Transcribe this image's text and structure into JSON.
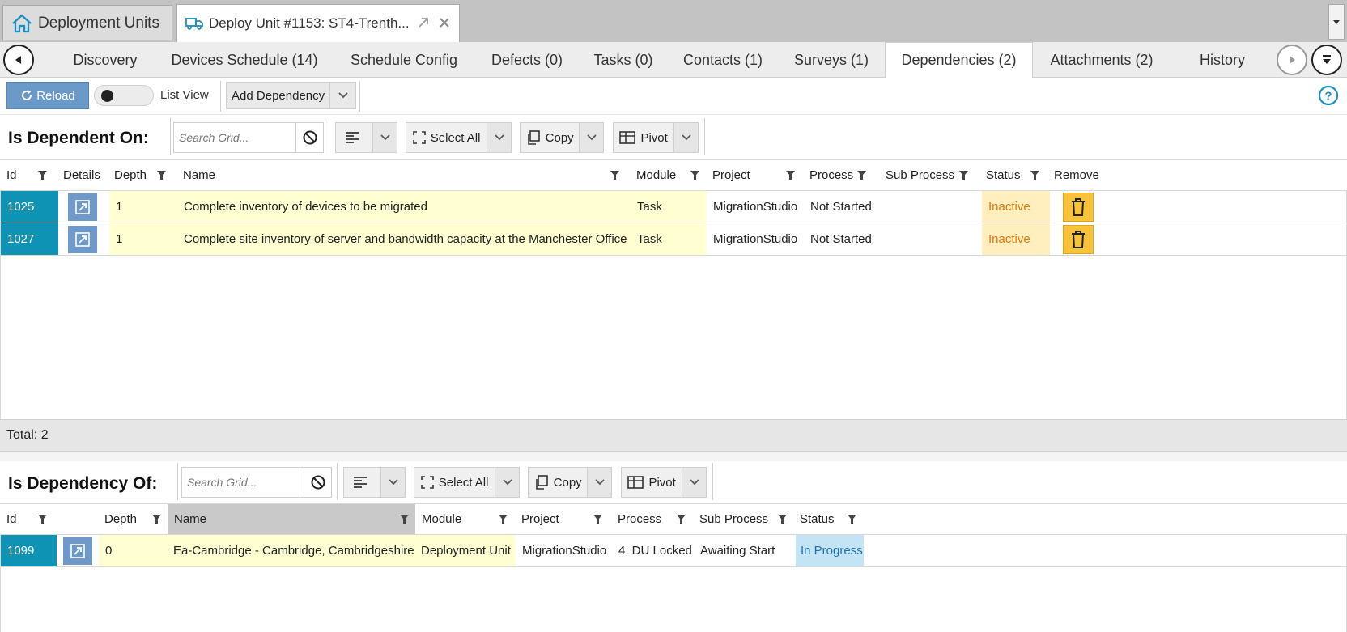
{
  "doc_tabs": {
    "home_tab": "Deployment Units",
    "active_tab": "Deploy Unit #1153: ST4-Trenth..."
  },
  "sub_tabs": [
    "Discovery",
    "Devices Schedule (14)",
    "Schedule Config",
    "Defects (0)",
    "Tasks (0)",
    "Contacts (1)",
    "Surveys (1)",
    "Dependencies (2)",
    "Attachments (2)",
    "History"
  ],
  "active_sub_tab": "Dependencies (2)",
  "toolbar": {
    "reload": "Reload",
    "list_view": "List View",
    "add_dependency": "Add Dependency"
  },
  "grid_tools": {
    "search_placeholder": "Search Grid...",
    "select_all": "Select All",
    "copy": "Copy",
    "pivot": "Pivot"
  },
  "dependent_on": {
    "title": "Is Dependent On:",
    "columns": [
      "Id",
      "Details",
      "Depth",
      "Name",
      "Module",
      "Project",
      "Process",
      "Sub Process",
      "Status",
      "Remove"
    ],
    "rows": [
      {
        "id": "1025",
        "depth": "1",
        "name": "Complete inventory of devices to be migrated",
        "module": "Task",
        "project": "MigrationStudio",
        "process": "Not Started",
        "sub_process": "",
        "status": "Inactive"
      },
      {
        "id": "1027",
        "depth": "1",
        "name": "Complete site inventory of server and bandwidth capacity at the Manchester Office",
        "module": "Task",
        "project": "MigrationStudio",
        "process": "Not Started",
        "sub_process": "",
        "status": "Inactive"
      }
    ],
    "total": "Total: 2"
  },
  "dependency_of": {
    "title": "Is Dependency Of:",
    "columns": [
      "Id",
      "",
      "Depth",
      "Name",
      "Module",
      "Project",
      "Process",
      "Sub Process",
      "Status"
    ],
    "rows": [
      {
        "id": "1099",
        "depth": "0",
        "name": "Ea-Cambridge - Cambridge, Cambridgeshire",
        "module": "Deployment Unit",
        "project": "MigrationStudio",
        "process": "4. DU Locked",
        "sub_process": "Awaiting Start",
        "status": "In Progress"
      }
    ]
  },
  "colors": {
    "id_cell": "#0f93b5",
    "reload_button": "#6b99c8",
    "status_inactive_text": "#e07b10",
    "status_inprogress_bg": "#c4e3f5",
    "remove_button": "#f8c338",
    "highlight_yellow": "#ffffd2"
  },
  "icons": [
    "home-icon",
    "truck-icon",
    "popout-icon",
    "close-icon",
    "chevron-left-icon",
    "chevron-right-icon",
    "overflow-menu-icon",
    "reload-icon",
    "help-icon",
    "clear-search-icon",
    "align-icon",
    "select-all-icon",
    "copy-icon",
    "pivot-icon",
    "open-details-icon",
    "trash-icon",
    "filter-icon"
  ]
}
